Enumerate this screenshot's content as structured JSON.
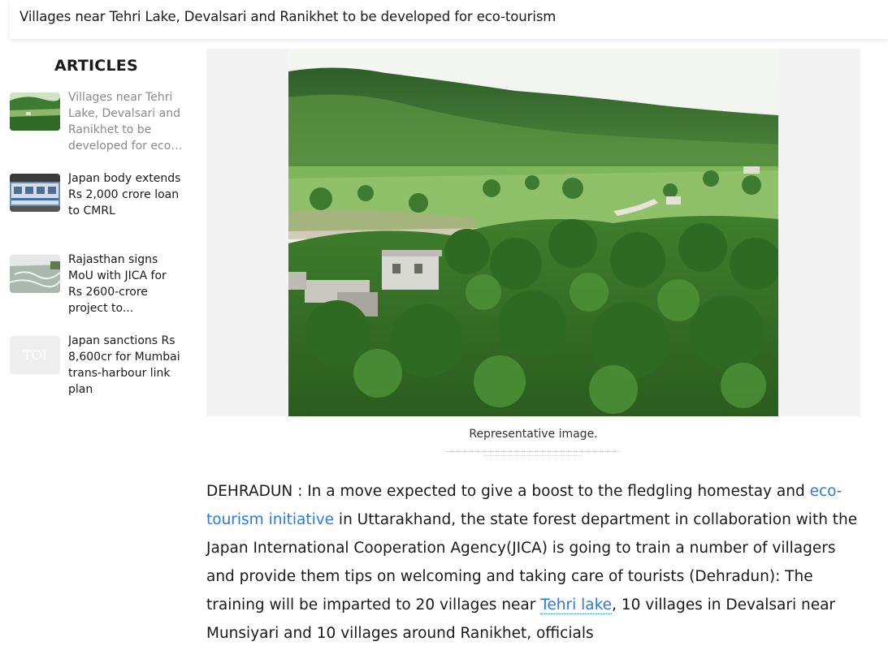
{
  "headline": "Villages near Tehri Lake, Devalsari and Ranikhet to be developed for eco-tourism",
  "sidebar": {
    "heading": "ARTICLES",
    "items": [
      {
        "label": "Villages near Tehri Lake, Devalsari and Ranikhet to be developed for eco-tourism",
        "thumb": "hills-thumbnail",
        "active": true
      },
      {
        "label": "Japan body extends Rs 2,000 crore loan to CMRL",
        "thumb": "metro-train-thumbnail",
        "active": false
      },
      {
        "label": "Rajasthan signs MoU with JICA for Rs 2600-crore project to...",
        "thumb": "water-thumbnail",
        "active": false
      },
      {
        "label": "Japan sanctions Rs 8,600cr for Mumbai trans-harbour link plan",
        "thumb": "toi-placeholder-thumbnail",
        "thumb_text": "TOI",
        "active": false
      }
    ]
  },
  "main": {
    "image_alt": "Green hills and village landscape",
    "caption": "Representative image.",
    "paragraph": {
      "p1": "DEHRADUN : In a move expected to give a boost to the fledgling homestay and ",
      "link1": "eco-tourism initiative",
      "p2": " in Uttarakhand, the state forest department in collaboration with the Japan International Cooperation Agency(JICA) is going to train a number of villagers and provide them tips on welcoming and taking care of tourists (Dehradun): The training will be imparted to 20 villages near ",
      "link2": "Tehri lake",
      "p3": ", 10 villages in Devalsari near Munsiyari and 10 villages around Ranikhet, officials"
    }
  },
  "colors": {
    "link": "#2a7ae2",
    "active_article": "#8a8a8a",
    "image_bg": "#f3f3f3"
  }
}
